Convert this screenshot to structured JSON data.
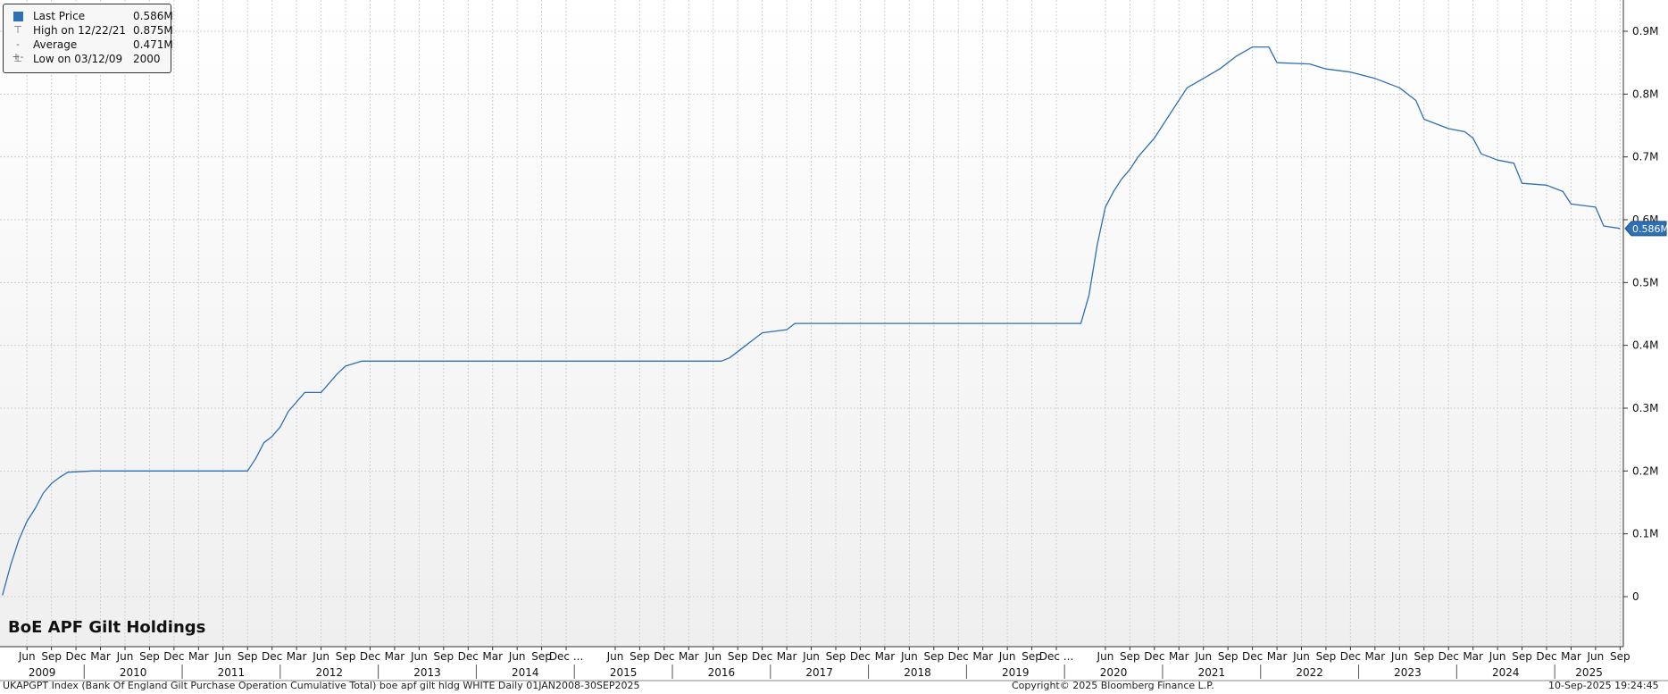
{
  "chart_title": "BoE APF Gilt Holdings",
  "legend": {
    "items": [
      {
        "label": "Last Price",
        "value": "0.586M",
        "icon": "square-swatch-icon"
      },
      {
        "label": "High on 12/22/21",
        "value": "0.875M",
        "icon": "high-marker-icon"
      },
      {
        "label": "Average",
        "value": "0.471M",
        "icon": "average-marker-icon"
      },
      {
        "label": "Low on 03/12/09",
        "value": "2000",
        "icon": "low-marker-icon"
      }
    ]
  },
  "last_price_tag": "0.586M",
  "footer": {
    "left": "UKAPGPT Index (Bank Of England Gilt Purchase Operation Cumulative Total) boe apf gilt hldg WHITE  Daily 01JAN2008-30SEP2025",
    "center": "Copyright© 2025 Bloomberg Finance L.P.",
    "right": "10-Sep-2025 19:24:45"
  },
  "colors": {
    "line": "#2f6fb5",
    "tag_bg": "#2f6fb5",
    "grid": "#cfcfcf"
  },
  "chart_data": {
    "type": "line",
    "title": "BoE APF Gilt Holdings",
    "series": [
      {
        "name": "Last Price",
        "points": [
          [
            "2009-03",
            0.002
          ],
          [
            "2009-04",
            0.05
          ],
          [
            "2009-05",
            0.09
          ],
          [
            "2009-06",
            0.12
          ],
          [
            "2009-07",
            0.14
          ],
          [
            "2009-08",
            0.165
          ],
          [
            "2009-09",
            0.18
          ],
          [
            "2009-10",
            0.19
          ],
          [
            "2009-11",
            0.198
          ],
          [
            "2010-02",
            0.2
          ],
          [
            "2011-09",
            0.2
          ],
          [
            "2011-10",
            0.22
          ],
          [
            "2011-11",
            0.245
          ],
          [
            "2011-12",
            0.255
          ],
          [
            "2012-01",
            0.27
          ],
          [
            "2012-02",
            0.295
          ],
          [
            "2012-03",
            0.31
          ],
          [
            "2012-04",
            0.325
          ],
          [
            "2012-06",
            0.325
          ],
          [
            "2012-07",
            0.34
          ],
          [
            "2012-08",
            0.355
          ],
          [
            "2012-09",
            0.367
          ],
          [
            "2012-11",
            0.375
          ],
          [
            "2016-07",
            0.375
          ],
          [
            "2016-08",
            0.38
          ],
          [
            "2016-09",
            0.39
          ],
          [
            "2016-10",
            0.4
          ],
          [
            "2016-11",
            0.41
          ],
          [
            "2016-12",
            0.42
          ],
          [
            "2017-03",
            0.425
          ],
          [
            "2017-04",
            0.435
          ],
          [
            "2020-03",
            0.435
          ],
          [
            "2020-04",
            0.48
          ],
          [
            "2020-05",
            0.56
          ],
          [
            "2020-06",
            0.62
          ],
          [
            "2020-07",
            0.645
          ],
          [
            "2020-08",
            0.665
          ],
          [
            "2020-09",
            0.68
          ],
          [
            "2020-10",
            0.7
          ],
          [
            "2020-12",
            0.73
          ],
          [
            "2021-02",
            0.77
          ],
          [
            "2021-04",
            0.81
          ],
          [
            "2021-06",
            0.825
          ],
          [
            "2021-08",
            0.84
          ],
          [
            "2021-10",
            0.86
          ],
          [
            "2021-12",
            0.875
          ],
          [
            "2022-02",
            0.875
          ],
          [
            "2022-03",
            0.85
          ],
          [
            "2022-07",
            0.848
          ],
          [
            "2022-09",
            0.84
          ],
          [
            "2022-12",
            0.835
          ],
          [
            "2023-03",
            0.825
          ],
          [
            "2023-06",
            0.81
          ],
          [
            "2023-08",
            0.79
          ],
          [
            "2023-09",
            0.76
          ],
          [
            "2023-12",
            0.745
          ],
          [
            "2024-02",
            0.74
          ],
          [
            "2024-03",
            0.73
          ],
          [
            "2024-04",
            0.705
          ],
          [
            "2024-06",
            0.695
          ],
          [
            "2024-08",
            0.69
          ],
          [
            "2024-09",
            0.658
          ],
          [
            "2024-12",
            0.655
          ],
          [
            "2025-02",
            0.645
          ],
          [
            "2025-03",
            0.625
          ],
          [
            "2025-06",
            0.62
          ],
          [
            "2025-07",
            0.59
          ],
          [
            "2025-09",
            0.586
          ]
        ]
      }
    ],
    "y_ticks": [
      {
        "value": 0,
        "label": "0"
      },
      {
        "value": 0.1,
        "label": "0.1M"
      },
      {
        "value": 0.2,
        "label": "0.2M"
      },
      {
        "value": 0.3,
        "label": "0.3M"
      },
      {
        "value": 0.4,
        "label": "0.4M"
      },
      {
        "value": 0.5,
        "label": "0.5M"
      },
      {
        "value": 0.6,
        "label": "0.6M"
      },
      {
        "value": 0.7,
        "label": "0.7M"
      },
      {
        "value": 0.8,
        "label": "0.8M"
      },
      {
        "value": 0.9,
        "label": "0.9M"
      }
    ],
    "x_month_labels": [
      [
        "2009-06",
        "Jun"
      ],
      [
        "2009-09",
        "Sep"
      ],
      [
        "2009-12",
        "Dec"
      ],
      [
        "2010-03",
        "Mar"
      ],
      [
        "2010-06",
        "Jun"
      ],
      [
        "2010-09",
        "Sep"
      ],
      [
        "2010-12",
        "Dec"
      ],
      [
        "2011-03",
        "Mar"
      ],
      [
        "2011-06",
        "Jun"
      ],
      [
        "2011-09",
        "Sep"
      ],
      [
        "2011-12",
        "Dec"
      ],
      [
        "2012-03",
        "Mar"
      ],
      [
        "2012-06",
        "Jun"
      ],
      [
        "2012-09",
        "Sep"
      ],
      [
        "2012-12",
        "Dec"
      ],
      [
        "2013-03",
        "Mar"
      ],
      [
        "2013-06",
        "Jun"
      ],
      [
        "2013-09",
        "Sep"
      ],
      [
        "2013-12",
        "Dec"
      ],
      [
        "2014-03",
        "Mar"
      ],
      [
        "2014-06",
        "Jun"
      ],
      [
        "2014-09",
        "Sep"
      ],
      [
        "2014-12",
        "Dec ..."
      ],
      [
        "2015-06",
        "Jun"
      ],
      [
        "2015-09",
        "Sep"
      ],
      [
        "2015-12",
        "Dec"
      ],
      [
        "2016-03",
        "Mar"
      ],
      [
        "2016-06",
        "Jun"
      ],
      [
        "2016-09",
        "Sep"
      ],
      [
        "2016-12",
        "Dec"
      ],
      [
        "2017-03",
        "Mar"
      ],
      [
        "2017-06",
        "Jun"
      ],
      [
        "2017-09",
        "Sep"
      ],
      [
        "2017-12",
        "Dec"
      ],
      [
        "2018-03",
        "Mar"
      ],
      [
        "2018-06",
        "Jun"
      ],
      [
        "2018-09",
        "Sep"
      ],
      [
        "2018-12",
        "Dec"
      ],
      [
        "2019-03",
        "Mar"
      ],
      [
        "2019-06",
        "Jun"
      ],
      [
        "2019-09",
        "Sep"
      ],
      [
        "2019-12",
        "Dec ..."
      ],
      [
        "2020-06",
        "Jun"
      ],
      [
        "2020-09",
        "Sep"
      ],
      [
        "2020-12",
        "Dec"
      ],
      [
        "2021-03",
        "Mar"
      ],
      [
        "2021-06",
        "Jun"
      ],
      [
        "2021-09",
        "Sep"
      ],
      [
        "2021-12",
        "Dec"
      ],
      [
        "2022-03",
        "Mar"
      ],
      [
        "2022-06",
        "Jun"
      ],
      [
        "2022-09",
        "Sep"
      ],
      [
        "2022-12",
        "Dec"
      ],
      [
        "2023-03",
        "Mar"
      ],
      [
        "2023-06",
        "Jun"
      ],
      [
        "2023-09",
        "Sep"
      ],
      [
        "2023-12",
        "Dec"
      ],
      [
        "2024-03",
        "Mar"
      ],
      [
        "2024-06",
        "Jun"
      ],
      [
        "2024-09",
        "Sep"
      ],
      [
        "2024-12",
        "Dec"
      ],
      [
        "2025-03",
        "Mar"
      ],
      [
        "2025-06",
        "Jun"
      ],
      [
        "2025-09",
        "Sep"
      ]
    ],
    "x_year_labels": [
      "2009",
      "2010",
      "2011",
      "2012",
      "2013",
      "2014",
      "2015",
      "2016",
      "2017",
      "2018",
      "2019",
      "2020",
      "2021",
      "2022",
      "2023",
      "2024",
      "2025"
    ],
    "x_range": [
      "2009-03",
      "2025-09"
    ],
    "ylim": [
      0,
      0.95
    ],
    "y_axis_side": "right",
    "grid": true,
    "legend_position": "top-left"
  }
}
